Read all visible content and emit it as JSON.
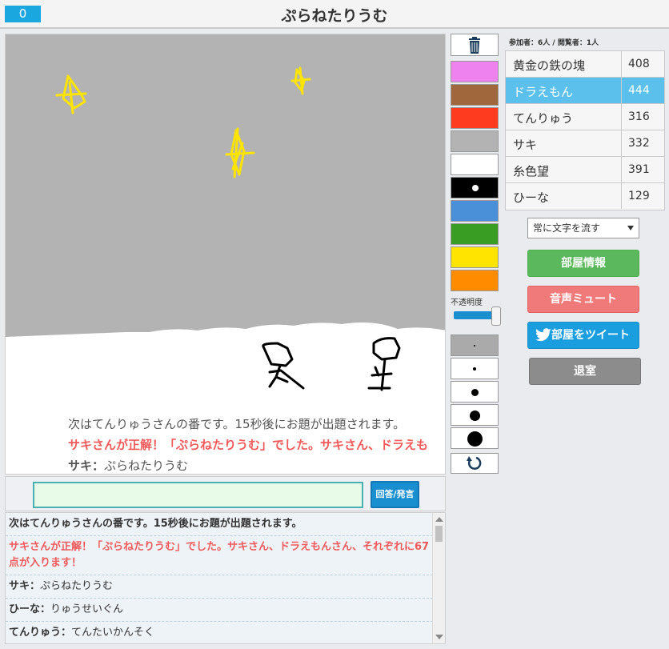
{
  "header": {
    "counter": "0",
    "title": "ぷらねたりうむ"
  },
  "canvas": {
    "overlay_lines": [
      "次はてんりゅうさんの番です。15秒後にお題が出題されます。",
      "サキさんが正解！「ぷらねたりうむ」でした。サキさん、ドラえも",
      {
        "name": "サキ：",
        "text": "ぷらねたりうむ"
      }
    ]
  },
  "answer": {
    "input_value": "",
    "button_label": "回答/発言"
  },
  "log": [
    {
      "style": "bold",
      "text": "次はてんりゅうさんの番です。15秒後にお題が出題されます。"
    },
    {
      "style": "red",
      "text": "サキさんが正解！「ぷらねたりうむ」でした。サキさん、ドラえもんさん、それぞれに67点が入ります！"
    },
    {
      "style": "chat",
      "name": "サキ：",
      "text": "ぷらねたりうむ"
    },
    {
      "style": "chat",
      "name": "ひーな：",
      "text": "りゅうせいぐん"
    },
    {
      "style": "chat",
      "name": "てんりゅう：",
      "text": "てんたいかんそく"
    }
  ],
  "tools": {
    "colors": [
      "#ee82ee",
      "#a0663c",
      "#ff3b1f",
      "#b3b3b3",
      "#ffffff",
      "#000000",
      "#4a90d9",
      "#3a9d23",
      "#ffe400",
      "#ff8c00"
    ],
    "opacity_label": "不透明度",
    "opacity_value": 1.0,
    "pen_sizes": [
      2,
      4,
      9,
      13,
      19
    ],
    "selected_size_index": 0
  },
  "participants": {
    "info": "参加者：6人 / 閲覧者：1人",
    "players": [
      {
        "name": "黄金の鉄の塊",
        "score": "408",
        "active": false
      },
      {
        "name": "ドラえもん",
        "score": "444",
        "active": true
      },
      {
        "name": "てんりゅう",
        "score": "316",
        "active": false
      },
      {
        "name": "サキ",
        "score": "332",
        "active": false
      },
      {
        "name": "糸色望",
        "score": "391",
        "active": false
      },
      {
        "name": "ひーな",
        "score": "129",
        "active": false
      }
    ]
  },
  "controls": {
    "text_flow_select": "常に文字を流す",
    "room_info_button": "部屋情報",
    "mute_button": "音声ミュート",
    "tweet_button": "部屋をツイート",
    "leave_button": "退室"
  }
}
